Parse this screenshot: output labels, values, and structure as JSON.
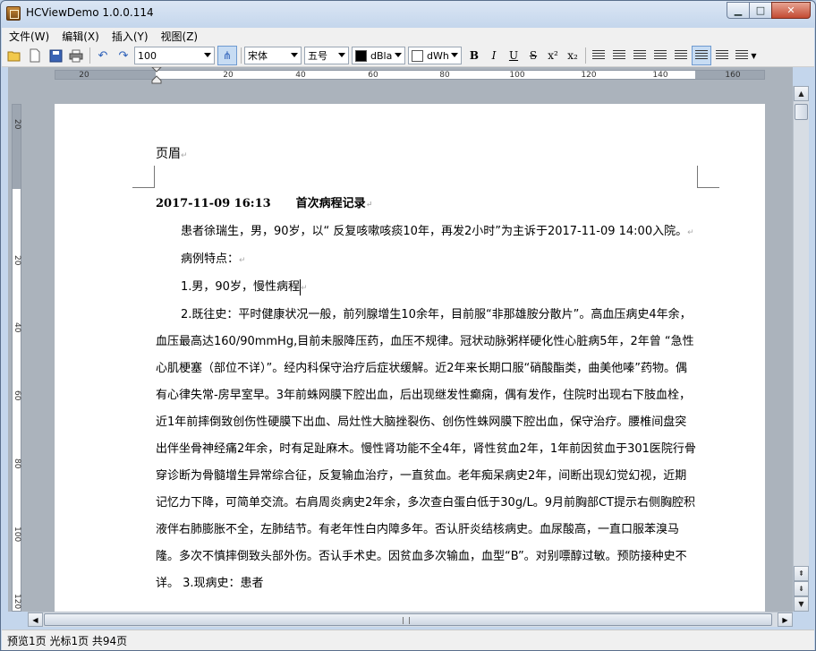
{
  "window": {
    "title": "HCViewDemo 1.0.0.114",
    "minimize": "▁",
    "maximize": "□",
    "close": "✕"
  },
  "menu": [
    "文件(W)",
    "编辑(X)",
    "插入(Y)",
    "视图(Z)"
  ],
  "toolbar": {
    "zoom": "100",
    "font_name": "宋体",
    "font_size": "五号",
    "text_color": "dBla",
    "text_color_hex": "#000000",
    "back_color": "dWh",
    "back_color_hex": "#ffffff",
    "bold": "B",
    "italic": "I",
    "underline": "U",
    "strike": "S",
    "superscript": "x²",
    "subscript": "x₂"
  },
  "ruler": {
    "h_ticks": [
      "20",
      "20",
      "40",
      "60",
      "80",
      "100",
      "120",
      "140",
      "160"
    ],
    "v_ticks": [
      "20",
      "20",
      "40",
      "60",
      "80",
      "100",
      "120"
    ]
  },
  "document": {
    "header": "页眉",
    "title_date": "2017-11-09 16:13",
    "title": "首次病程记录",
    "para1": "患者徐瑞生，男，90岁，以“ 反复咳嗽咳痰10年，再发2小时”为主诉于2017-11-09 14:00入院。",
    "para2": "病例特点：",
    "para3": "1.男，90岁，慢性病程",
    "para4": "2.既往史：平时健康状况一般，前列腺增生10余年，目前服“非那雄胺分散片”。高血压病史4年余，血压最高达160/90mmHg,目前未服降压药，血压不规律。冠状动脉粥样硬化性心脏病5年，2年曾 “急性心肌梗塞（部位不详）”。经内科保守治疗后症状缓解。近2年来长期口服“硝酸酯类，曲美他嗪”药物。偶有心律失常-房早室早。3年前蛛网膜下腔出血，后出现继发性癫痫，偶有发作，住院时出现右下肢血栓，近1年前摔倒致创伤性硬膜下出血、局灶性大脑挫裂伤、创伤性蛛网膜下腔出血，保守治疗。腰椎间盘突出伴坐骨神经痛2年余，时有足趾麻木。慢性肾功能不全4年，肾性贫血2年，1年前因贫血于301医院行骨穿诊断为骨髓增生异常综合征，反复输血治疗，一直贫血。老年痴呆病史2年，间断出现幻觉幻视，近期记忆力下降，可简单交流。右肩周炎病史2年余，多次查白蛋白低于30g/L。9月前胸部CT提示右侧胸腔积液伴右肺膨胀不全，左肺结节。有老年性白内障多年。否认肝炎结核病史。血尿酸高，一直口服苯溴马隆。多次不慎摔倒致头部外伤。否认手术史。因贫血多次输血，血型“B”。对别嘌醇过敏。预防接种史不详。      3.现病史：患者"
  },
  "status": "预览1页 光标1页 共94页"
}
